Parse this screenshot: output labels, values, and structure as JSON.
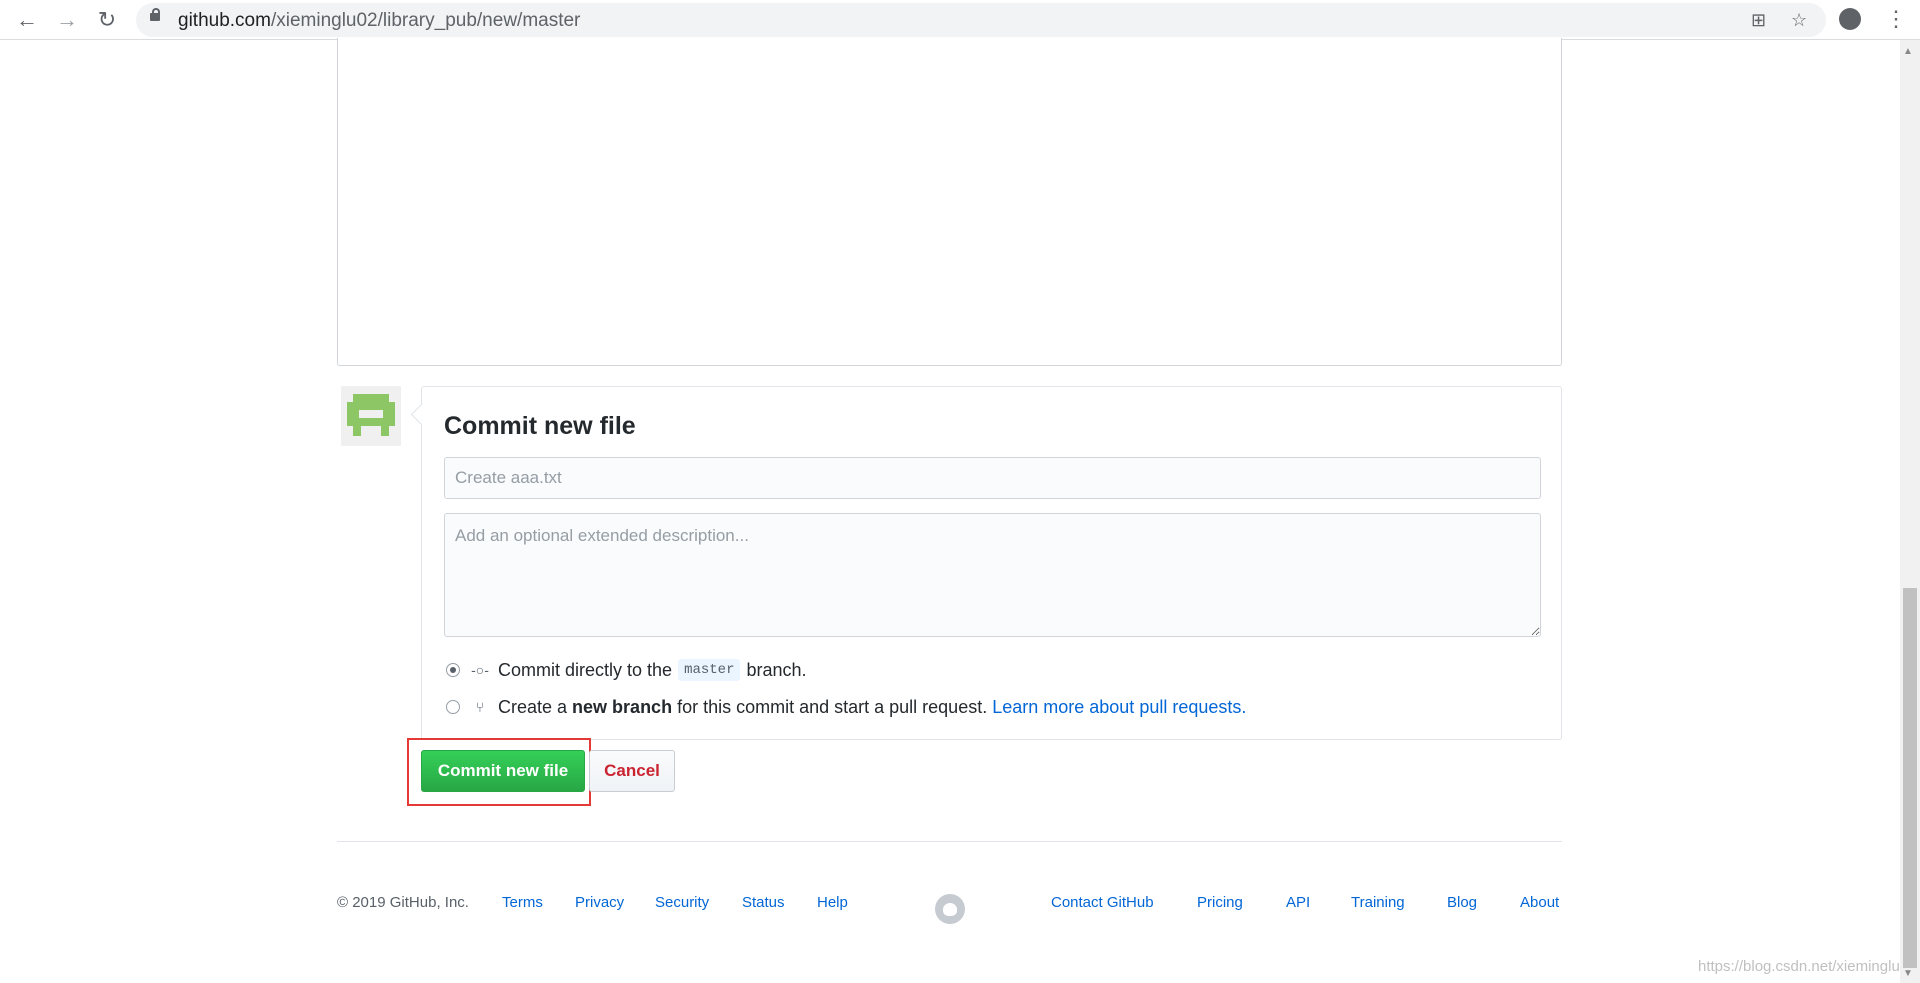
{
  "browser": {
    "url_host": "github.com",
    "url_path": "/xieminglu02/library_pub/new/master"
  },
  "commit": {
    "title": "Commit new file",
    "summary_placeholder": "Create aaa.txt",
    "description_placeholder": "Add an optional extended description...",
    "option_direct": {
      "prefix": "Commit directly to the",
      "branch": "master",
      "suffix": "branch."
    },
    "option_new_branch": {
      "prefix": "Create a",
      "bold": "new branch",
      "suffix": "for this commit and start a pull request.",
      "link": "Learn more about pull requests."
    },
    "submit_label": "Commit new file",
    "cancel_label": "Cancel"
  },
  "footer": {
    "copyright": "© 2019 GitHub, Inc.",
    "left_links": [
      "Terms",
      "Privacy",
      "Security",
      "Status",
      "Help"
    ],
    "right_links": [
      "Contact GitHub",
      "Pricing",
      "API",
      "Training",
      "Blog",
      "About"
    ]
  },
  "watermark": "https://blog.csdn.net/xieminglu",
  "colors": {
    "accent_green": "#28a745",
    "link_blue": "#0366d6",
    "cancel_red": "#cb2431",
    "highlight_red": "#e53935",
    "avatar_green": "#8cc665"
  },
  "icons": [
    "back-arrow-icon",
    "forward-arrow-icon",
    "reload-icon",
    "lock-icon",
    "translate-icon",
    "star-icon",
    "profile-icon",
    "menu-kebab-icon",
    "git-commit-icon",
    "git-pull-request-icon",
    "github-logo-icon"
  ]
}
